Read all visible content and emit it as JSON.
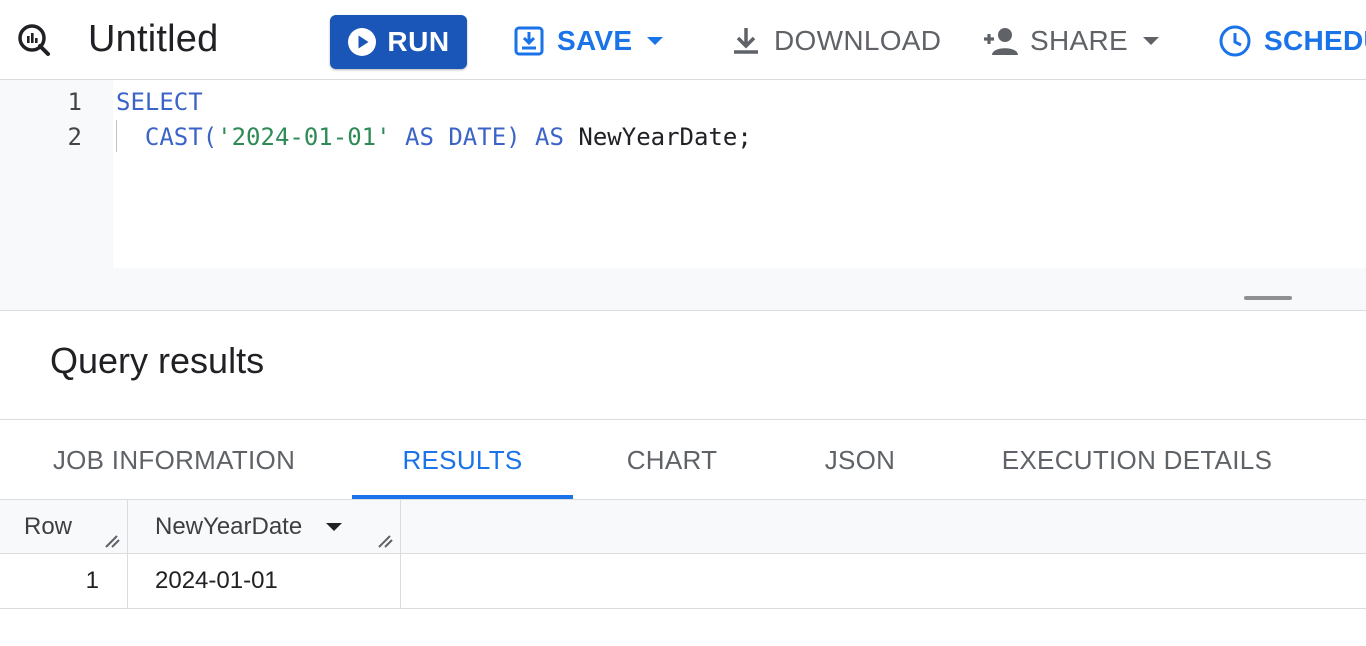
{
  "toolbar": {
    "title": "Untitled",
    "run_label": "RUN",
    "save_label": "SAVE",
    "download_label": "DOWNLOAD",
    "share_label": "SHARE",
    "schedule_label": "SCHEDU",
    "icons": [
      "query-icon",
      "play-icon",
      "save-icon",
      "download-icon",
      "person-add-icon",
      "clock-icon",
      "dropdown-arrow-icon"
    ]
  },
  "editor": {
    "lines": [
      {
        "number": "1",
        "tokens": [
          {
            "type": "kw",
            "text": "SELECT"
          }
        ]
      },
      {
        "number": "2",
        "tokens": [
          {
            "type": "kw",
            "text": "  CAST("
          },
          {
            "type": "str",
            "text": "'2024-01-01'"
          },
          {
            "type": "kw",
            "text": " AS DATE) AS "
          },
          {
            "type": "plain",
            "text": "NewYearDate;"
          }
        ]
      }
    ]
  },
  "results": {
    "title": "Query results",
    "tabs": [
      "JOB INFORMATION",
      "RESULTS",
      "CHART",
      "JSON",
      "EXECUTION DETAILS"
    ],
    "active_tab": "RESULTS",
    "columns": [
      "Row",
      "NewYearDate"
    ],
    "rows": [
      {
        "row": "1",
        "NewYearDate": "2024-01-01"
      }
    ]
  },
  "colors": {
    "primary": "#1a73e8",
    "run_button": "#1a56b8",
    "keyword": "#3c64c8",
    "string": "#2e8b57"
  }
}
